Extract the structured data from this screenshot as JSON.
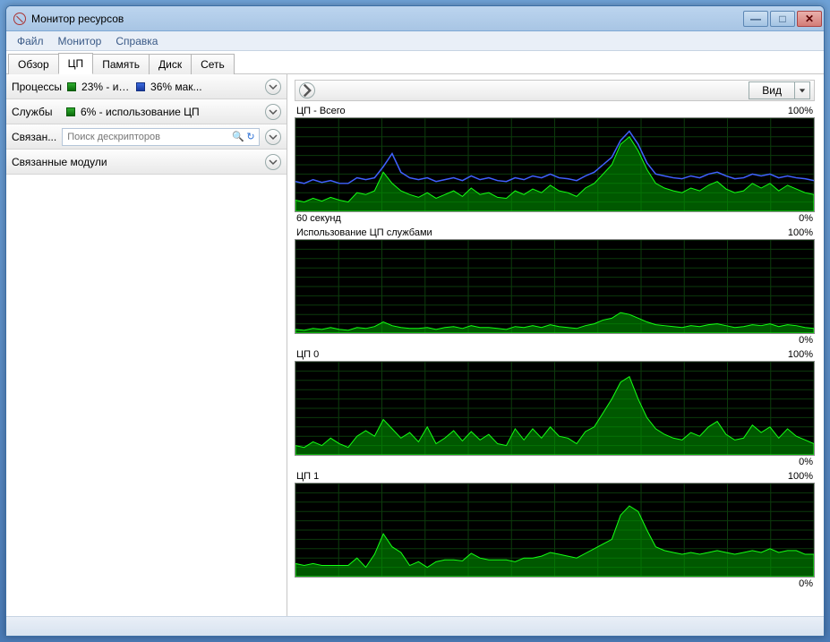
{
  "window": {
    "title": "Монитор ресурсов"
  },
  "menu": {
    "file": "Файл",
    "monitor": "Монитор",
    "help": "Справка"
  },
  "tabs": {
    "overview": "Обзор",
    "cpu": "ЦП",
    "memory": "Память",
    "disk": "Диск",
    "network": "Сеть"
  },
  "sidebar": {
    "processes": {
      "label": "Процессы",
      "usage": "23% - ис...",
      "max": "36% мак..."
    },
    "services": {
      "label": "Службы",
      "usage": "6% - использование ЦП"
    },
    "handles": {
      "label": "Связан...",
      "placeholder": "Поиск дескрипторов"
    },
    "modules": {
      "label": "Связанные модули"
    }
  },
  "main": {
    "view_button": "Вид",
    "timespan": "60 секунд"
  },
  "chart_data": [
    {
      "type": "area",
      "title": "ЦП - Всего",
      "ylabel_top": "100%",
      "ylabel_bottom": "0%",
      "xlabel": "60 секунд",
      "ylim": [
        0,
        100
      ],
      "series": [
        {
          "name": "usage",
          "color": "#00c000",
          "values": [
            12,
            10,
            14,
            11,
            15,
            12,
            10,
            20,
            18,
            22,
            42,
            30,
            22,
            18,
            15,
            20,
            14,
            18,
            22,
            16,
            25,
            18,
            20,
            15,
            14,
            22,
            18,
            24,
            20,
            28,
            22,
            20,
            16,
            25,
            30,
            40,
            50,
            72,
            80,
            65,
            45,
            30,
            25,
            22,
            20,
            25,
            22,
            28,
            32,
            24,
            20,
            22,
            30,
            25,
            30,
            22,
            28,
            24,
            20,
            18
          ]
        },
        {
          "name": "max_freq",
          "color": "#4060ff",
          "style": "line",
          "values": [
            32,
            30,
            34,
            31,
            33,
            30,
            30,
            36,
            34,
            36,
            48,
            62,
            42,
            36,
            34,
            36,
            32,
            34,
            36,
            33,
            38,
            34,
            36,
            33,
            32,
            36,
            34,
            38,
            36,
            40,
            36,
            35,
            33,
            38,
            42,
            50,
            58,
            76,
            86,
            72,
            52,
            40,
            38,
            36,
            35,
            38,
            36,
            40,
            42,
            38,
            35,
            36,
            40,
            38,
            40,
            36,
            38,
            36,
            35,
            33
          ]
        }
      ]
    },
    {
      "type": "area",
      "title": "Использование ЦП службами",
      "ylabel_top": "100%",
      "ylabel_bottom": "0%",
      "ylim": [
        0,
        100
      ],
      "series": [
        {
          "name": "services",
          "color": "#00c000",
          "values": [
            4,
            3,
            5,
            4,
            6,
            4,
            3,
            6,
            5,
            7,
            12,
            8,
            6,
            5,
            5,
            6,
            4,
            6,
            7,
            5,
            8,
            6,
            6,
            5,
            4,
            7,
            6,
            8,
            6,
            9,
            7,
            6,
            5,
            8,
            10,
            14,
            16,
            22,
            20,
            16,
            12,
            9,
            8,
            7,
            6,
            8,
            7,
            9,
            10,
            8,
            6,
            7,
            9,
            8,
            10,
            7,
            9,
            8,
            6,
            5
          ]
        }
      ]
    },
    {
      "type": "area",
      "title": "ЦП 0",
      "ylabel_top": "100%",
      "ylabel_bottom": "0%",
      "ylim": [
        0,
        100
      ],
      "series": [
        {
          "name": "cpu0",
          "color": "#00c000",
          "values": [
            10,
            8,
            14,
            10,
            18,
            12,
            8,
            20,
            26,
            20,
            38,
            28,
            18,
            24,
            14,
            30,
            12,
            18,
            26,
            15,
            25,
            16,
            22,
            12,
            10,
            28,
            16,
            28,
            18,
            30,
            20,
            18,
            12,
            25,
            30,
            45,
            60,
            78,
            84,
            60,
            40,
            28,
            22,
            18,
            16,
            24,
            20,
            30,
            36,
            22,
            16,
            18,
            32,
            24,
            30,
            18,
            28,
            20,
            16,
            12
          ]
        }
      ]
    },
    {
      "type": "area",
      "title": "ЦП 1",
      "ylabel_top": "100%",
      "ylabel_bottom": "0%",
      "ylim": [
        0,
        100
      ],
      "series": [
        {
          "name": "cpu1",
          "color": "#00c000",
          "values": [
            14,
            12,
            14,
            12,
            12,
            12,
            12,
            20,
            10,
            24,
            46,
            32,
            26,
            12,
            16,
            10,
            16,
            18,
            18,
            17,
            25,
            20,
            18,
            18,
            18,
            16,
            20,
            20,
            22,
            26,
            24,
            22,
            20,
            25,
            30,
            35,
            40,
            66,
            76,
            70,
            50,
            32,
            28,
            26,
            24,
            26,
            24,
            26,
            28,
            26,
            24,
            26,
            28,
            26,
            30,
            26,
            28,
            28,
            24,
            24
          ]
        }
      ]
    }
  ]
}
